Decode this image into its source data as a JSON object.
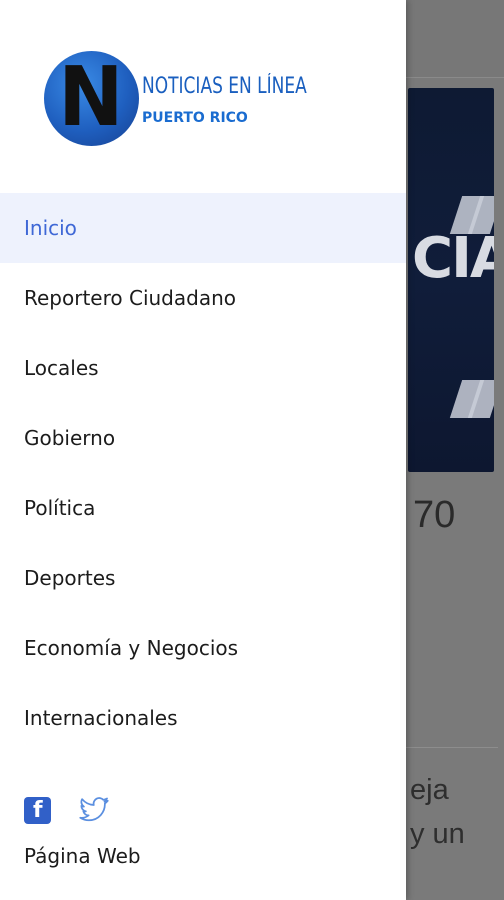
{
  "app": {
    "logo": {
      "title": "NOTICIAS EN LÍNEA",
      "subtitle": "PUERTO RICO",
      "monogram": "N"
    }
  },
  "drawer": {
    "menu_items": [
      {
        "label": "Inicio",
        "active": true
      },
      {
        "label": "Reportero Ciudadano"
      },
      {
        "label": "Locales"
      },
      {
        "label": "Gobierno"
      },
      {
        "label": "Política"
      },
      {
        "label": "Deportes"
      },
      {
        "label": "Economía y Negocios"
      },
      {
        "label": "Internacionales"
      }
    ],
    "social": {
      "facebook_icon": "facebook-icon",
      "twitter_icon": "twitter-icon"
    },
    "web_page_label": "Página Web"
  },
  "background": {
    "headline_fragment": "70",
    "snippet_line1": "eja",
    "snippet_line2": "y un"
  },
  "colors": {
    "active_bg": "#eef2fd",
    "active_text": "#3f68d6",
    "brand_blue": "#1a5fbf",
    "facebook_blue": "#3160c8",
    "twitter_blue": "#5b8fe0"
  }
}
